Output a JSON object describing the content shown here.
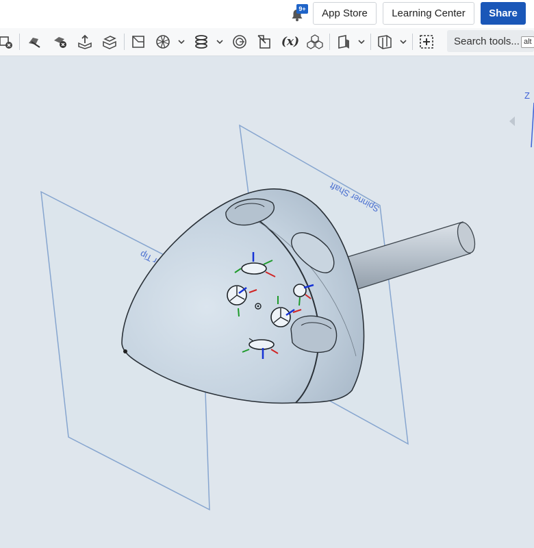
{
  "header": {
    "notification_count": "9+",
    "app_store_label": "App Store",
    "learning_center_label": "Learning Center",
    "share_label": "Share"
  },
  "toolbar": {
    "variable_label": "(x)",
    "search_label": "Search tools...",
    "search_shortcut": "alt"
  },
  "viewport": {
    "plane_spinner_tip": "Spinner Tip",
    "plane_spinner_shaft": "Spinner Shaft",
    "axis_z": "Z"
  },
  "colors": {
    "accent": "#1a57b8",
    "viewport_bg": "#dfe6ed",
    "plane_line": "#7fa1cf",
    "part_fill": "#c7d5e2",
    "part_edge": "#2a3138"
  }
}
